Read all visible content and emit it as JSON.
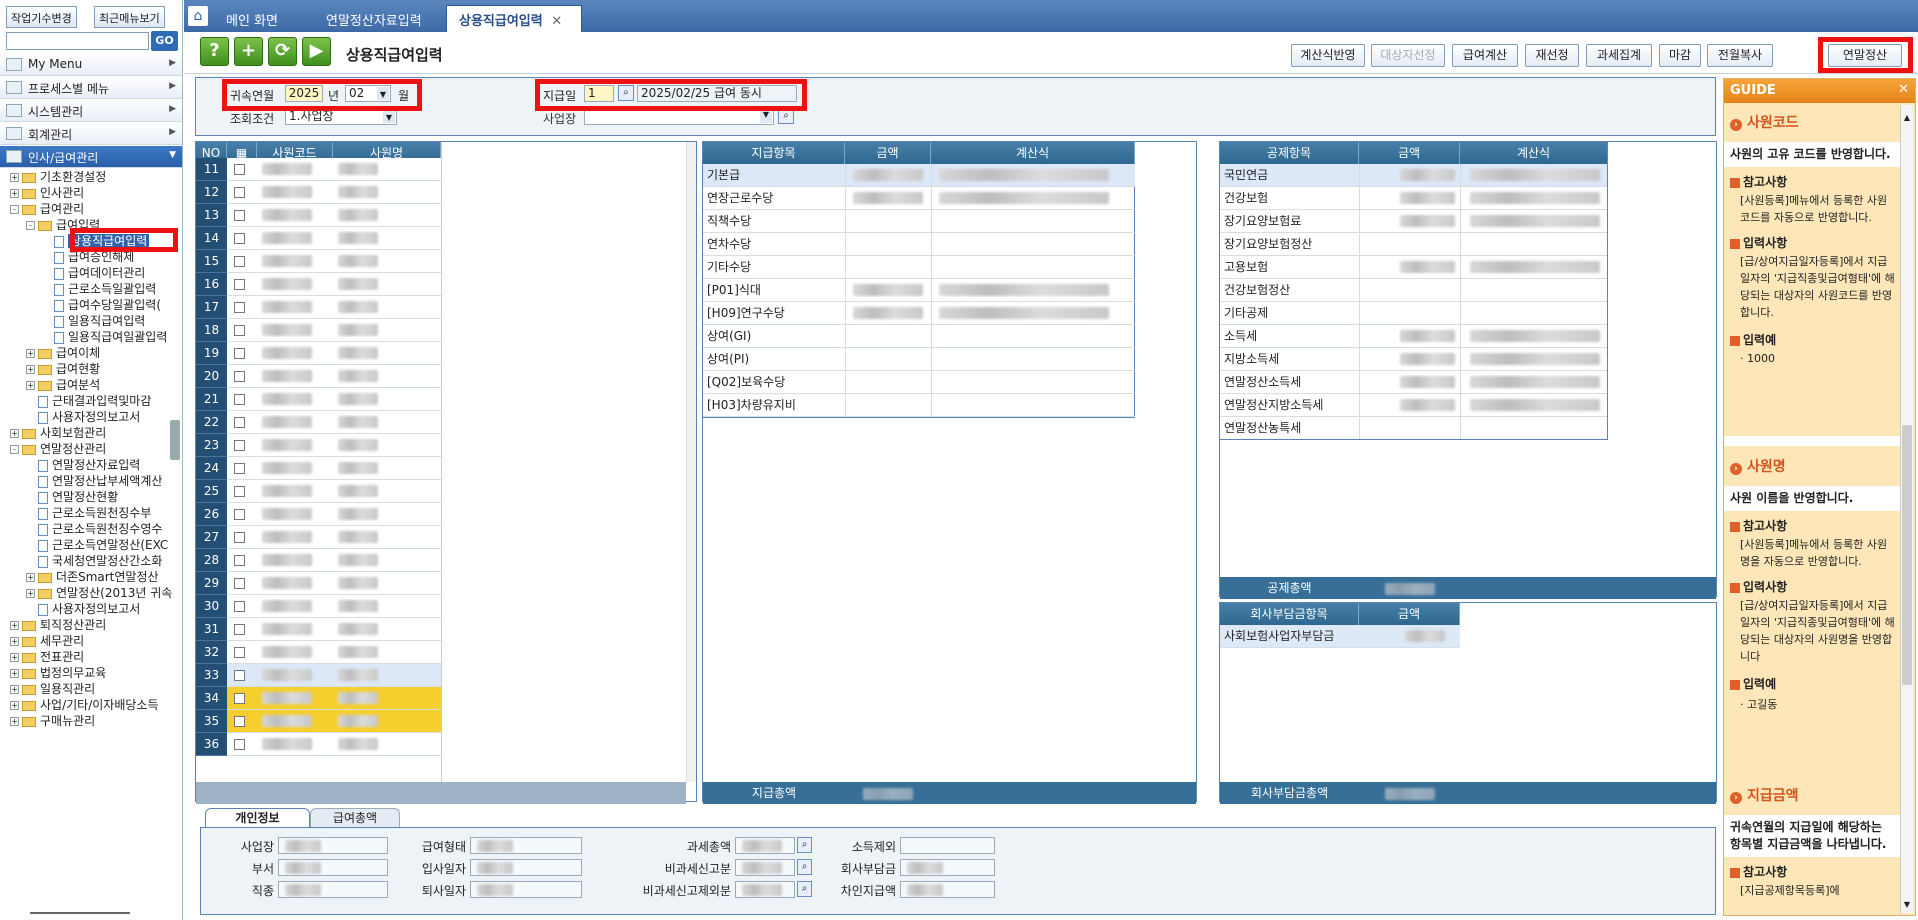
{
  "sidebar": {
    "top_buttons": [
      "작업기수변경",
      "최근메뉴보기"
    ],
    "go_label": "GO",
    "menus": [
      "My Menu",
      "프로세스별 메뉴",
      "시스템관리",
      "회계관리",
      "인사/급여관리"
    ],
    "tree": [
      {
        "label": "기초환경설정",
        "level": 1,
        "kind": "folder",
        "pm": "+"
      },
      {
        "label": "인사관리",
        "level": 1,
        "kind": "folder",
        "pm": "+"
      },
      {
        "label": "급여관리",
        "level": 1,
        "kind": "folder",
        "pm": "-"
      },
      {
        "label": "급여입력",
        "level": 2,
        "kind": "folder",
        "pm": "-"
      },
      {
        "label": "상용직급여입력",
        "level": 3,
        "kind": "doc",
        "selected": true
      },
      {
        "label": "급여승인해제",
        "level": 3,
        "kind": "doc"
      },
      {
        "label": "급여데이터관리",
        "level": 3,
        "kind": "doc"
      },
      {
        "label": "근로소득일괄입력",
        "level": 3,
        "kind": "doc"
      },
      {
        "label": "급여수당일괄입력(",
        "level": 3,
        "kind": "doc"
      },
      {
        "label": "일용직급여입력",
        "level": 3,
        "kind": "doc"
      },
      {
        "label": "일용직급여일괄입력",
        "level": 3,
        "kind": "doc"
      },
      {
        "label": "급여이체",
        "level": 2,
        "kind": "folder",
        "pm": "+"
      },
      {
        "label": "급여현황",
        "level": 2,
        "kind": "folder",
        "pm": "+"
      },
      {
        "label": "급여분석",
        "level": 2,
        "kind": "folder",
        "pm": "+"
      },
      {
        "label": "근태결과입력및마감",
        "level": 2,
        "kind": "doc"
      },
      {
        "label": "사용자정의보고서",
        "level": 2,
        "kind": "doc"
      },
      {
        "label": "사회보험관리",
        "level": 1,
        "kind": "folder",
        "pm": "+"
      },
      {
        "label": "연말정산관리",
        "level": 1,
        "kind": "folder",
        "pm": "-"
      },
      {
        "label": "연말정산자료입력",
        "level": 2,
        "kind": "doc"
      },
      {
        "label": "연말정산납부세액계산",
        "level": 2,
        "kind": "doc"
      },
      {
        "label": "연말정산현황",
        "level": 2,
        "kind": "doc"
      },
      {
        "label": "근로소득원천징수부",
        "level": 2,
        "kind": "doc"
      },
      {
        "label": "근로소득원천징수영수",
        "level": 2,
        "kind": "doc"
      },
      {
        "label": "근로소득연말정산(EXC",
        "level": 2,
        "kind": "doc"
      },
      {
        "label": "국세청연말정산간소화",
        "level": 2,
        "kind": "doc"
      },
      {
        "label": "더존Smart연말정산",
        "level": 2,
        "kind": "folder",
        "pm": "+"
      },
      {
        "label": "연말정산(2013년 귀속",
        "level": 2,
        "kind": "folder",
        "pm": "+"
      },
      {
        "label": "사용자정의보고서",
        "level": 2,
        "kind": "doc"
      },
      {
        "label": "퇴직정산관리",
        "level": 1,
        "kind": "folder",
        "pm": "+"
      },
      {
        "label": "세무관리",
        "level": 1,
        "kind": "folder",
        "pm": "+"
      },
      {
        "label": "전표관리",
        "level": 1,
        "kind": "folder",
        "pm": "+"
      },
      {
        "label": "법정의무교육",
        "level": 1,
        "kind": "folder",
        "pm": "+"
      },
      {
        "label": "일용직관리",
        "level": 1,
        "kind": "folder",
        "pm": "+"
      },
      {
        "label": "사업/기타/이자배당소득",
        "level": 1,
        "kind": "folder",
        "pm": "+"
      },
      {
        "label": "구매뉴관리",
        "level": 1,
        "kind": "folder",
        "pm": "+"
      }
    ]
  },
  "tabs": [
    "메인 화면",
    "연말정산자료입력",
    "상용직급여입력"
  ],
  "page_title": "상용직급여입력",
  "action_buttons": [
    {
      "label": "계산식반영",
      "disabled": false
    },
    {
      "label": "대상자선정",
      "disabled": true
    },
    {
      "label": "급여계산",
      "disabled": false
    },
    {
      "label": "재선정",
      "disabled": false
    },
    {
      "label": "과세집계",
      "disabled": false
    },
    {
      "label": "마감",
      "disabled": false
    },
    {
      "label": "전월복사",
      "disabled": false
    },
    {
      "label": "연말정산",
      "disabled": false
    }
  ],
  "filters": {
    "period_label": "귀속연월",
    "year": "2025",
    "year_unit": "년",
    "month": "02",
    "month_unit": "월",
    "query_label": "조회조건",
    "query_value": "1.사업장",
    "payday_label": "지급일",
    "payday_no": "1",
    "payday_desc": "2025/02/25 급여 동시",
    "site_label": "사업장"
  },
  "emp_grid": {
    "headers": [
      "NO",
      "사원코드",
      "사원명"
    ],
    "rows": [
      "11",
      "12",
      "13",
      "14",
      "15",
      "16",
      "17",
      "18",
      "19",
      "20",
      "21",
      "22",
      "23",
      "24",
      "25",
      "26",
      "27",
      "28",
      "29",
      "30",
      "31",
      "32",
      "33",
      "34",
      "35",
      "36"
    ]
  },
  "pay_grid": {
    "headers": [
      "지급항목",
      "금액",
      "계산식"
    ],
    "items": [
      "기본급",
      "연장근로수당",
      "직책수당",
      "연차수당",
      "기타수당",
      "[P01]식대",
      "[H09]연구수당",
      "상여(GI)",
      "상여(PI)",
      "[Q02]보육수당",
      "[H03]차량유지비"
    ],
    "total_label": "지급총액"
  },
  "deduct_grid": {
    "headers": [
      "공제항목",
      "금액",
      "계산식"
    ],
    "items": [
      "국민연금",
      "건강보험",
      "장기요양보험료",
      "장기요양보험정산",
      "고용보험",
      "건강보험정산",
      "기타공제",
      "소득세",
      "지방소득세",
      "연말정산소득세",
      "연말정산지방소득세",
      "연말정산농특세"
    ],
    "total_label": "공제총액"
  },
  "company_grid": {
    "headers": [
      "회사부담금항목",
      "금액"
    ],
    "items": [
      "사회보험사업자부담금"
    ],
    "total_label": "회사부담금총액"
  },
  "bottom_tabs": [
    "개인정보",
    "급여총액"
  ],
  "bottom_fields": {
    "col1": [
      "사업장",
      "부서",
      "직종"
    ],
    "col2": [
      "급여형태",
      "입사일자",
      "퇴사일자"
    ],
    "col3": [
      "과세총액",
      "비과세신고분",
      "비과세신고제외분"
    ],
    "col4": [
      "소득제외",
      "회사부담금",
      "차인지급액"
    ]
  },
  "guide": {
    "title": "GUIDE",
    "sections": [
      {
        "heading": "사원코드",
        "desc": "사원의 고유 코드를 반영합니다.",
        "note_label": "참고사항",
        "note": "[사원등록]메뉴에서 등록한 사원코드를 자동으로 반영합니다.",
        "input_label": "입력사항",
        "input": "[급/상여지급일자등록]에서 지급일자의 '지급직종및급여형태'에 해당되는 대상자의 사원코드를 반영합니다.",
        "ex_label": "입력예",
        "ex": "1000"
      },
      {
        "heading": "사원명",
        "desc": "사원 이름을 반영합니다.",
        "note_label": "참고사항",
        "note": "[사원등록]메뉴에서 등록한 사원명을 자동으로 반영합니다.",
        "input_label": "입력사항",
        "input": "[급/상여지급일자등록]에서 지급일자의 '지급직종및급여형태'에 해당되는 대상자의 사원명을 반영합니다",
        "ex_label": "입력예",
        "ex": "고길동"
      },
      {
        "heading": "지급금액",
        "desc": "귀속연월의 지급일에 해당하는 항목별 지급금액을 나타냅니다.",
        "note_label": "참고사항",
        "note": "[지급공제항목등록]에"
      }
    ]
  },
  "colors": {
    "highlight_red": "#ee1111",
    "header_blue": "#2e6890",
    "guide_bg": "#fde7b8",
    "yellow_row": "#f5cf2e"
  }
}
